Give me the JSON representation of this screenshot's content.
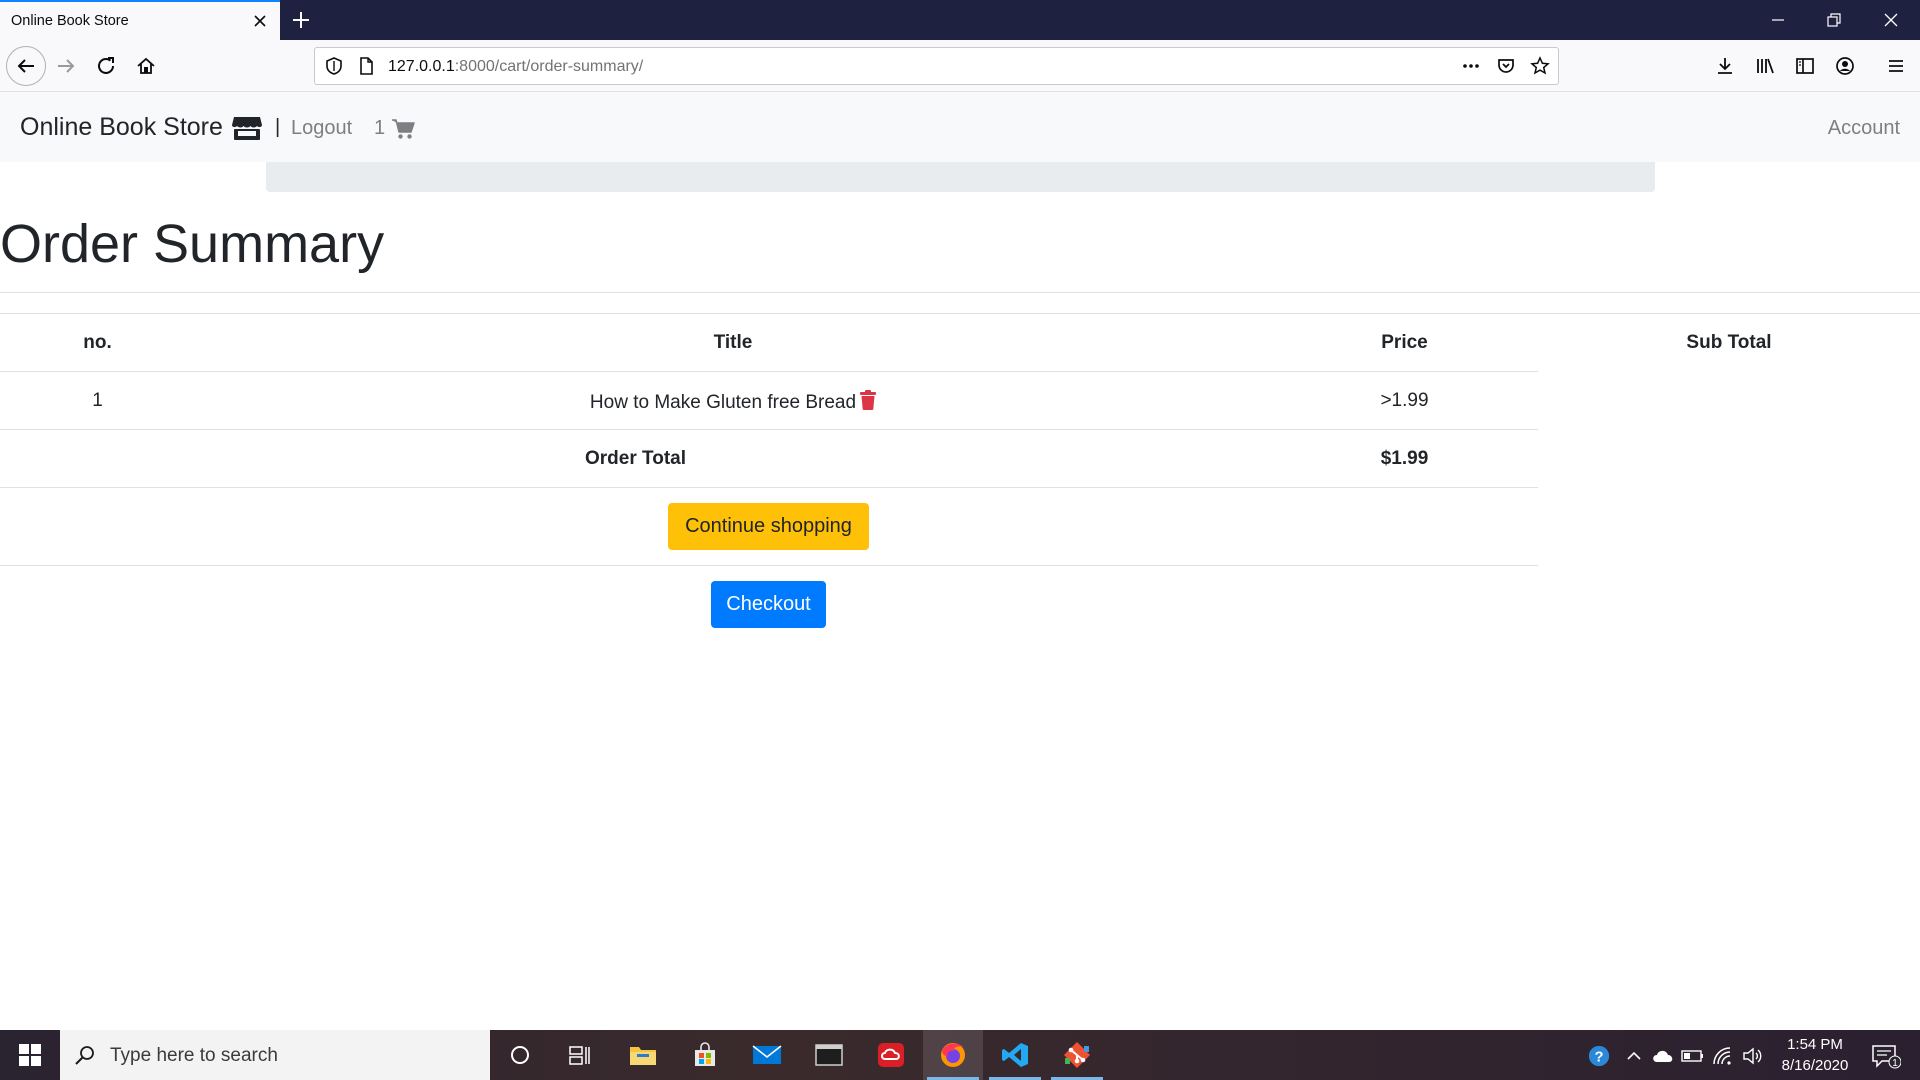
{
  "browser": {
    "tab_title": "Online Book Store",
    "url_host": "127.0.0.1",
    "url_path": ":8000/cart/order-summary/"
  },
  "navbar": {
    "brand": "Online Book Store",
    "separator": "|",
    "logout": "Logout",
    "cart_count": "1",
    "account": "Account"
  },
  "page": {
    "title": "Order Summary",
    "table": {
      "headers": [
        "no.",
        "Title",
        "Price",
        "Sub Total"
      ],
      "rows": [
        {
          "no": "1",
          "title": "How to Make Gluten free Bread",
          "price": ">1.99"
        }
      ],
      "order_total_label": "Order Total",
      "order_total_value": "$1.99"
    },
    "continue_label": "Continue shopping",
    "checkout_label": "Checkout"
  },
  "taskbar": {
    "search_placeholder": "Type here to search",
    "time": "1:54 PM",
    "date": "8/16/2020",
    "notification_count": "1"
  },
  "colors": {
    "primary": "#007bff",
    "warning": "#ffc107",
    "danger": "#dc3545"
  }
}
